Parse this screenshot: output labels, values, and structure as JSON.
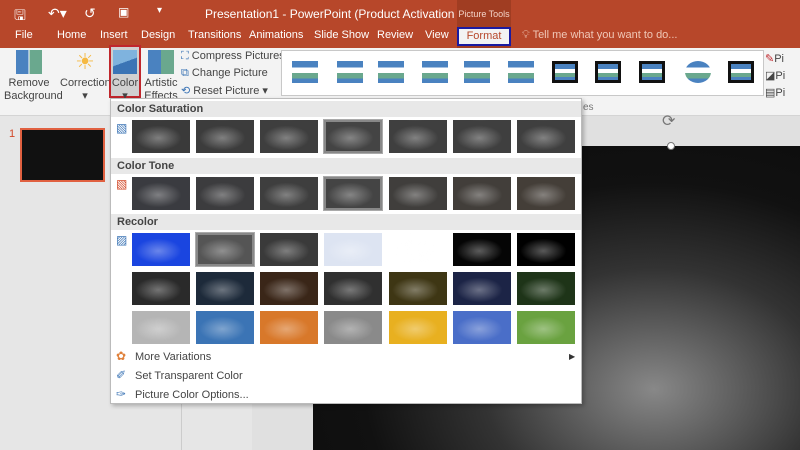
{
  "titlebar": {
    "title": "Presentation1 - PowerPoint (Product Activation Failed)",
    "context_tab": "Picture Tools"
  },
  "tabs": [
    "File",
    "Home",
    "Insert",
    "Design",
    "Transitions",
    "Animations",
    "Slide Show",
    "Review",
    "View"
  ],
  "active_tab": "Format",
  "tell_me": "Tell me what you want to do...",
  "ribbon": {
    "remove_background": [
      "Remove",
      "Background"
    ],
    "corrections": "Corrections",
    "color": "Color",
    "artistic": [
      "Artistic",
      "Effects"
    ],
    "compress": "Compress Pictures",
    "change": "Change Picture",
    "reset": "Reset Picture",
    "right_labels": [
      "Pi",
      "Pi",
      "Pi"
    ],
    "group_label_fragment": "es"
  },
  "slide_number": "1",
  "menu": {
    "sections": [
      "Color Saturation",
      "Color Tone",
      "Recolor"
    ],
    "saturation": [
      "#3a3a3a",
      "#3c3c3c",
      "#3e3e3e",
      "#444444",
      "#3f3f3f",
      "#3f3f3f",
      "#3f3f3f"
    ],
    "tone": [
      "#3a3b40",
      "#3c3c3e",
      "#3e3e3e",
      "#444444",
      "#403e3c",
      "#423e3a",
      "#443e38"
    ],
    "recolor": [
      [
        "#1a45e0",
        "#555555",
        "#3a3a3a",
        "#dde4f2",
        "#ffffff",
        "#050505",
        "#000000"
      ],
      [
        "#2a2a2a",
        "#1d2a3a",
        "#3a2618",
        "#303030",
        "#3e3614",
        "#1c2446",
        "#1e3418"
      ],
      [
        "#b5b5b5",
        "#3b74b5",
        "#d8782a",
        "#8a8a8a",
        "#e8b020",
        "#4a6ec8",
        "#6aa240"
      ]
    ],
    "selected": {
      "saturation": 3,
      "tone": 3,
      "recolor": 1
    },
    "items": [
      "More Variations",
      "Set Transparent Color",
      "Picture Color Options..."
    ]
  },
  "colors": {
    "accent": "#b7472a",
    "selection": "#c0262c",
    "focus": "#1a1aa0"
  }
}
